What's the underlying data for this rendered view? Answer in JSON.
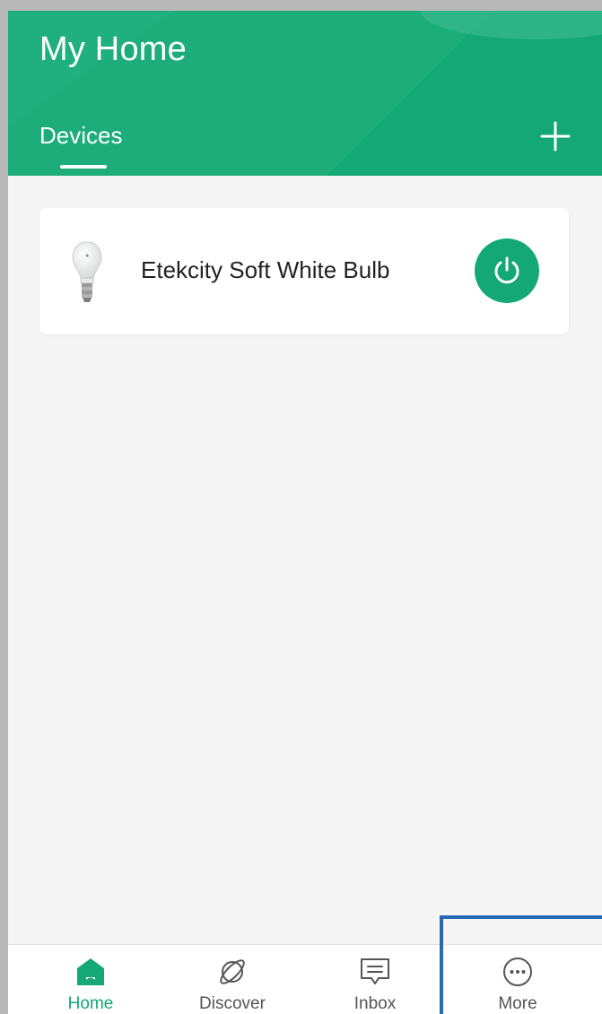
{
  "header": {
    "title": "My Home",
    "tab_label": "Devices",
    "add_icon": "plus-icon"
  },
  "devices": [
    {
      "name": "Etekcity Soft White Bulb",
      "icon": "light-bulb-icon",
      "power_icon": "power-icon"
    }
  ],
  "bottom_nav": {
    "items": [
      {
        "label": "Home",
        "icon": "home-icon",
        "active": true
      },
      {
        "label": "Discover",
        "icon": "planet-icon",
        "active": false
      },
      {
        "label": "Inbox",
        "icon": "message-icon",
        "active": false
      },
      {
        "label": "More",
        "icon": "more-dots-icon",
        "active": false
      }
    ]
  },
  "colors": {
    "brand": "#13a876",
    "background": "#f5f5f5",
    "highlight": "#2b68b4"
  }
}
